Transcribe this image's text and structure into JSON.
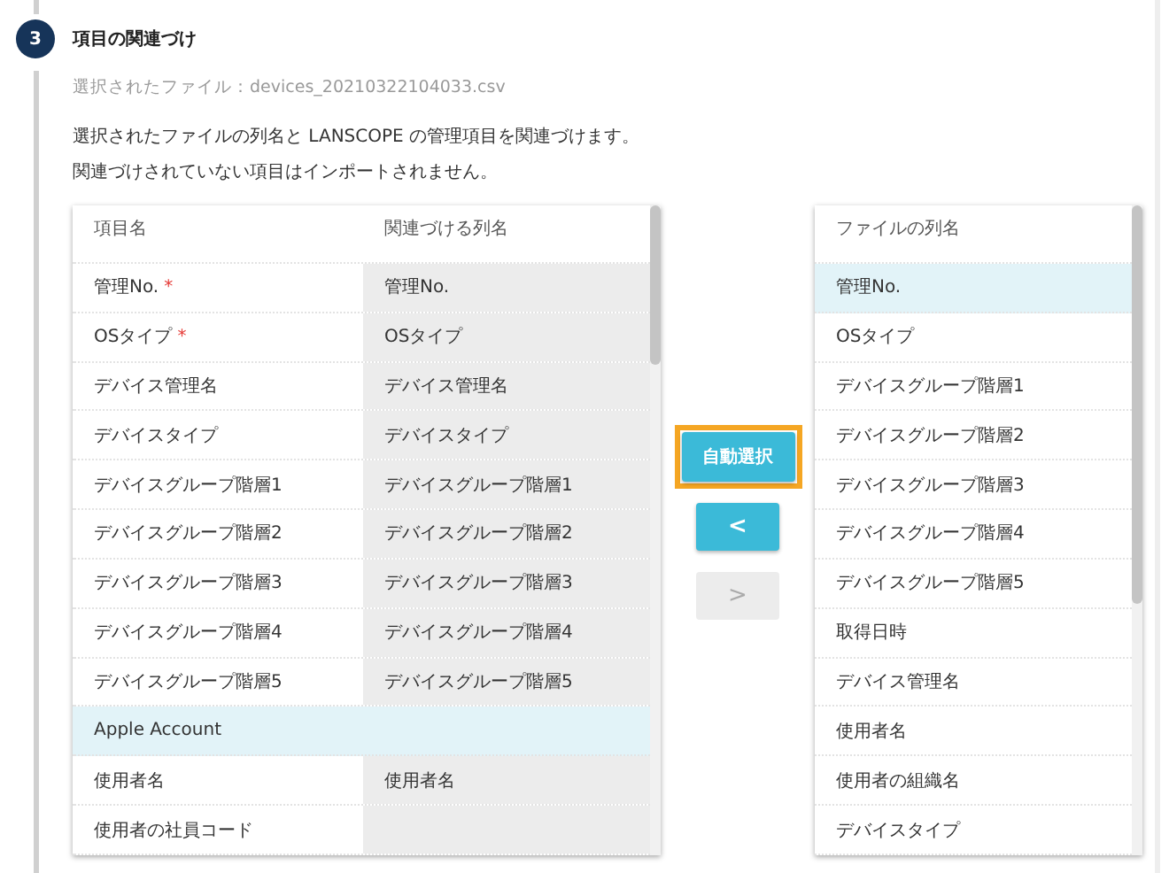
{
  "step": {
    "number": "3",
    "title": "項目の関連づけ"
  },
  "selected_file": "選択されたファイル：devices_20210322104033.csv",
  "description": [
    "選択されたファイルの列名と LANSCOPE の管理項目を関連づけます。",
    "関連づけされていない項目はインポートされません。"
  ],
  "mapping_table": {
    "columns": [
      "項目名",
      "関連づける列名"
    ],
    "rows": [
      {
        "name": "管理No.",
        "required_mark": "*",
        "mapped": "管理No.",
        "selected": false
      },
      {
        "name": "OSタイプ",
        "required_mark": "*",
        "mapped": "OSタイプ",
        "selected": false
      },
      {
        "name": "デバイス管理名",
        "mapped": "デバイス管理名",
        "selected": false
      },
      {
        "name": "デバイスタイプ",
        "mapped": "デバイスタイプ",
        "selected": false
      },
      {
        "name": "デバイスグループ階層1",
        "mapped": "デバイスグループ階層1",
        "selected": false
      },
      {
        "name": "デバイスグループ階層2",
        "mapped": "デバイスグループ階層2",
        "selected": false
      },
      {
        "name": "デバイスグループ階層3",
        "mapped": "デバイスグループ階層3",
        "selected": false
      },
      {
        "name": "デバイスグループ階層4",
        "mapped": "デバイスグループ階層4",
        "selected": false
      },
      {
        "name": "デバイスグループ階層5",
        "mapped": "デバイスグループ階層5",
        "selected": false
      },
      {
        "name": "Apple Account",
        "selected": true
      },
      {
        "name": "使用者名",
        "mapped": "使用者名",
        "selected": false
      },
      {
        "name": "使用者の社員コード",
        "selected": false
      }
    ]
  },
  "buttons": [
    {
      "kind": "auto",
      "label": "自動選択",
      "highlighted": true,
      "disabled": false
    },
    {
      "kind": "assign",
      "label": "<",
      "disabled": false
    },
    {
      "kind": "unassign",
      "label": ">",
      "disabled": true
    }
  ],
  "file_columns": {
    "title": "ファイルの列名",
    "rows": [
      {
        "name": "管理No.",
        "selected": true
      },
      {
        "name": "OSタイプ",
        "selected": false
      },
      {
        "name": "デバイスグループ階層1",
        "selected": false
      },
      {
        "name": "デバイスグループ階層2",
        "selected": false
      },
      {
        "name": "デバイスグループ階層3",
        "selected": false
      },
      {
        "name": "デバイスグループ階層4",
        "selected": false
      },
      {
        "name": "デバイスグループ階層5",
        "selected": false
      },
      {
        "name": "取得日時",
        "selected": false
      },
      {
        "name": "デバイス管理名",
        "selected": false
      },
      {
        "name": "使用者名",
        "selected": false
      },
      {
        "name": "使用者の組織名",
        "selected": false
      },
      {
        "name": "デバイスタイプ",
        "selected": false
      }
    ]
  }
}
